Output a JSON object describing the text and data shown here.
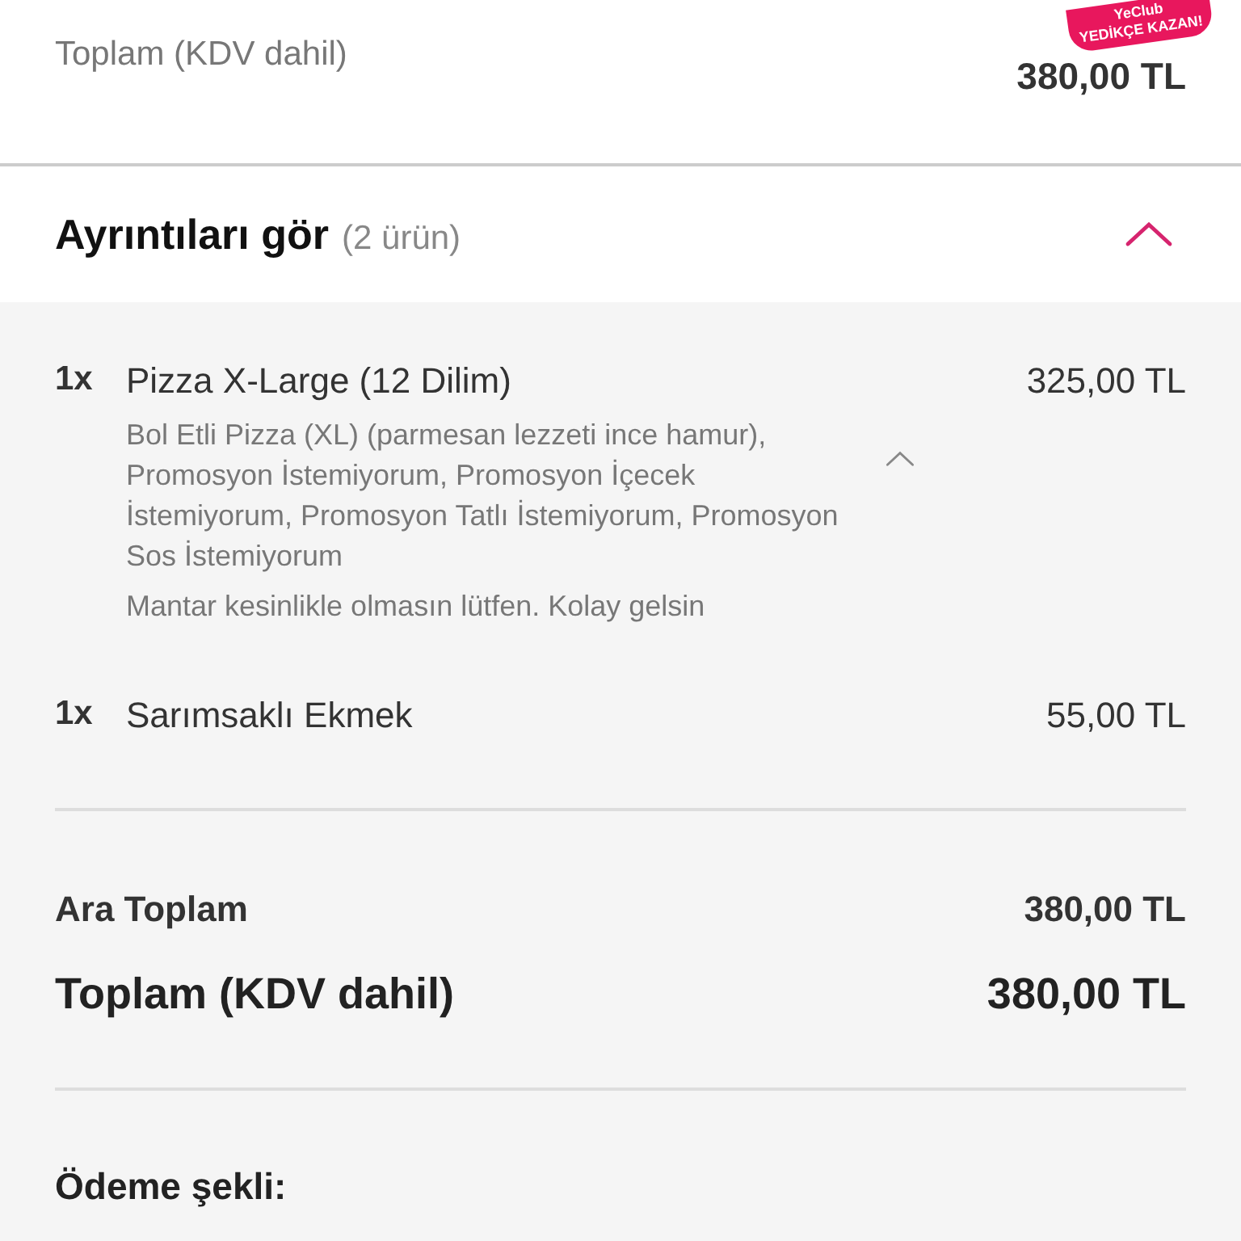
{
  "badge": {
    "brand": "YeClub",
    "slogan": "YEDİKÇE KAZAN!"
  },
  "summary": {
    "label": "Toplam (KDV dahil)",
    "value": "380,00 TL"
  },
  "details": {
    "title": "Ayrıntıları gör",
    "count": "(2 ürün)",
    "expanded": true
  },
  "items": [
    {
      "qty": "1x",
      "name": "Pizza X-Large (12 Dilim)",
      "price": "325,00 TL",
      "options": "Bol Etli Pizza (XL) (parmesan lezzeti ince hamur), Promosyon İstemiyorum, Promosyon İçecek İstemiyorum, Promosyon Tatlı İstemiyorum, Promosyon Sos İstemiyorum",
      "note": "Mantar kesinlikle olmasın lütfen. Kolay gelsin",
      "expanded": true
    },
    {
      "qty": "1x",
      "name": "Sarımsaklı Ekmek",
      "price": "55,00 TL"
    }
  ],
  "totals": [
    {
      "label": "Ara Toplam",
      "value": "380,00 TL",
      "kind": "subtotal"
    },
    {
      "label": "Toplam (KDV dahil)",
      "value": "380,00 TL",
      "kind": "total"
    }
  ],
  "payment": {
    "label": "Ödeme şekli:"
  }
}
